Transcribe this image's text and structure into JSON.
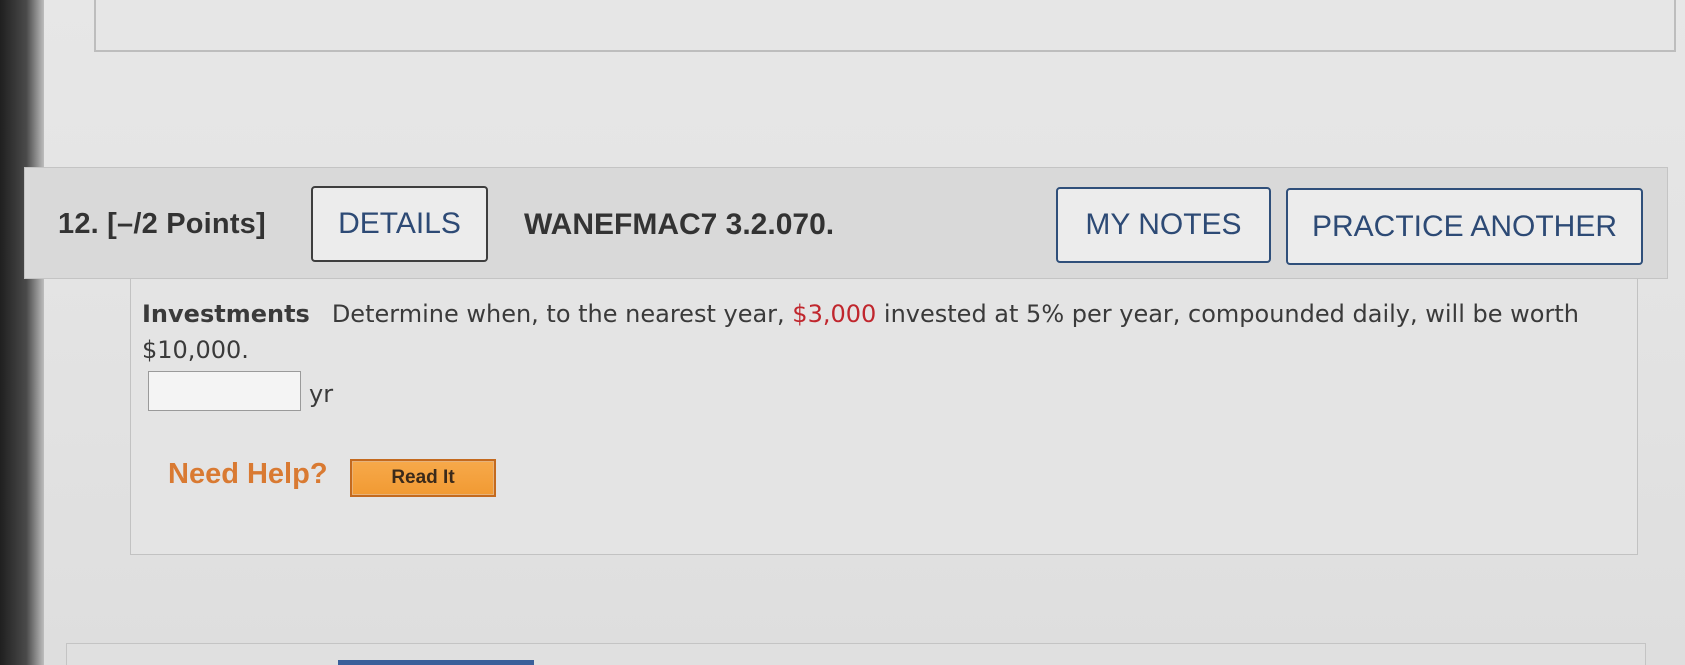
{
  "question": {
    "number_label": "12.  [–/2 Points]",
    "details_label": "DETAILS",
    "code": "WANEFMAC7 3.2.070.",
    "my_notes_label": "MY NOTES",
    "practice_label": "PRACTICE ANOTHER"
  },
  "problem": {
    "topic": "Investments",
    "text_before": "Determine when, to the nearest year, ",
    "principal": "$3,000",
    "text_after": " invested at 5% per year, compounded daily, will be worth $10,000.",
    "answer_value": "",
    "unit": "yr"
  },
  "help": {
    "label": "Need Help?",
    "read_it_label": "Read It"
  },
  "colors": {
    "accent_blue": "#2d4a75",
    "money_red": "#c0262d",
    "help_orange": "#d97a32",
    "button_orange": "#f19a33"
  }
}
